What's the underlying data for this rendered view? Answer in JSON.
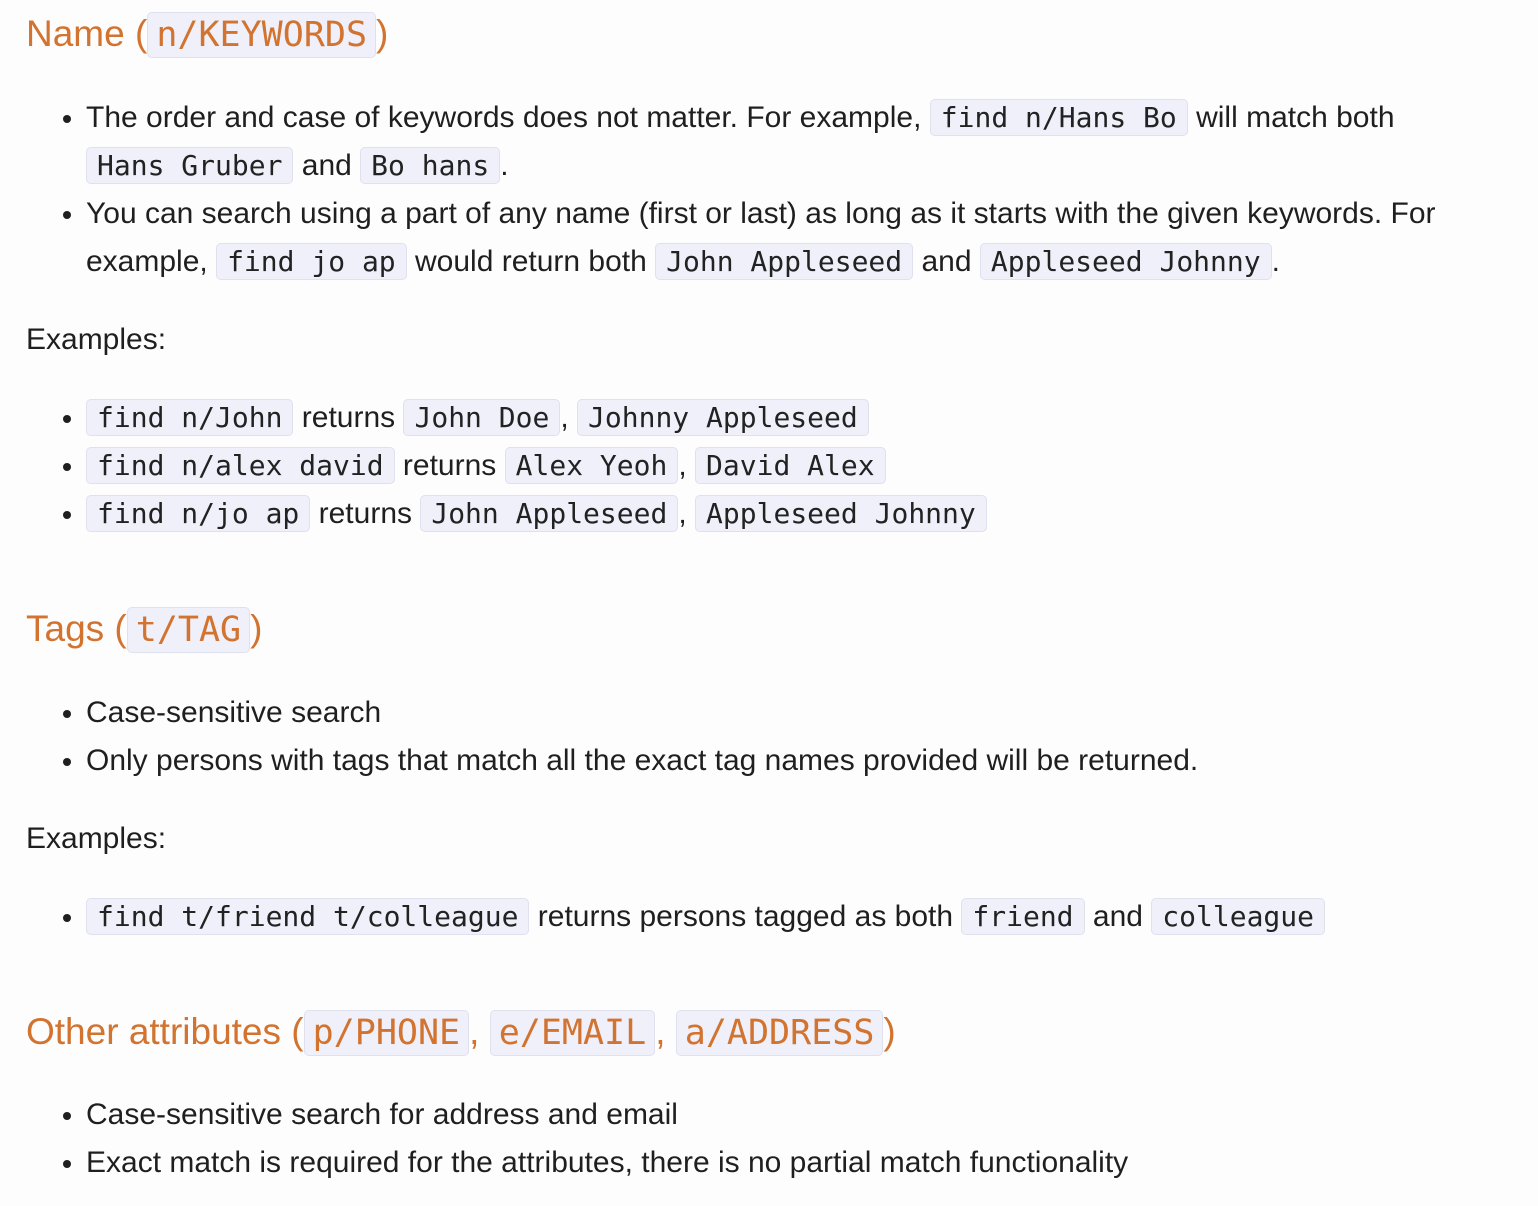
{
  "name_section": {
    "heading_prefix": "Name (",
    "heading_code": "n/KEYWORDS",
    "heading_suffix": ")",
    "bullets": [
      {
        "t1": "The order and case of keywords does not matter. For example, ",
        "c1": "find n/Hans Bo",
        "t2": " will match both ",
        "c2": "Hans Gruber",
        "t3": " and ",
        "c3": "Bo hans",
        "t4": "."
      },
      {
        "t1": "You can search using a part of any name (first or last) as long as it starts with the given keywords. For example, ",
        "c1": "find jo ap",
        "t2": " would return both ",
        "c2": "John Appleseed",
        "t3": " and ",
        "c3": "Appleseed Johnny",
        "t4": "."
      }
    ],
    "examples_label": "Examples:",
    "examples": [
      {
        "cmd": "find n/John",
        "returns": " returns ",
        "r1": "John Doe",
        "sep": ", ",
        "r2": "Johnny Appleseed"
      },
      {
        "cmd": "find n/alex david",
        "returns": " returns ",
        "r1": "Alex Yeoh",
        "sep": ", ",
        "r2": "David Alex"
      },
      {
        "cmd": "find n/jo ap",
        "returns": " returns ",
        "r1": "John Appleseed",
        "sep": ", ",
        "r2": "Appleseed Johnny"
      }
    ]
  },
  "tags_section": {
    "heading_prefix": "Tags (",
    "heading_code": "t/TAG",
    "heading_suffix": ")",
    "bullets": [
      "Case-sensitive search",
      "Only persons with tags that match all the exact tag names provided will be returned."
    ],
    "examples_label": "Examples:",
    "example": {
      "cmd": "find t/friend t/colleague",
      "t1": " returns persons tagged as both ",
      "c1": "friend",
      "t2": " and ",
      "c2": "colleague"
    }
  },
  "other_section": {
    "heading_prefix": "Other attributes (",
    "codes": [
      "p/PHONE",
      "e/EMAIL",
      "a/ADDRESS"
    ],
    "sep": ", ",
    "heading_suffix": ")",
    "bullets": [
      "Case-sensitive search for address and email",
      "Exact match is required for the attributes, there is no partial match functionality"
    ]
  }
}
